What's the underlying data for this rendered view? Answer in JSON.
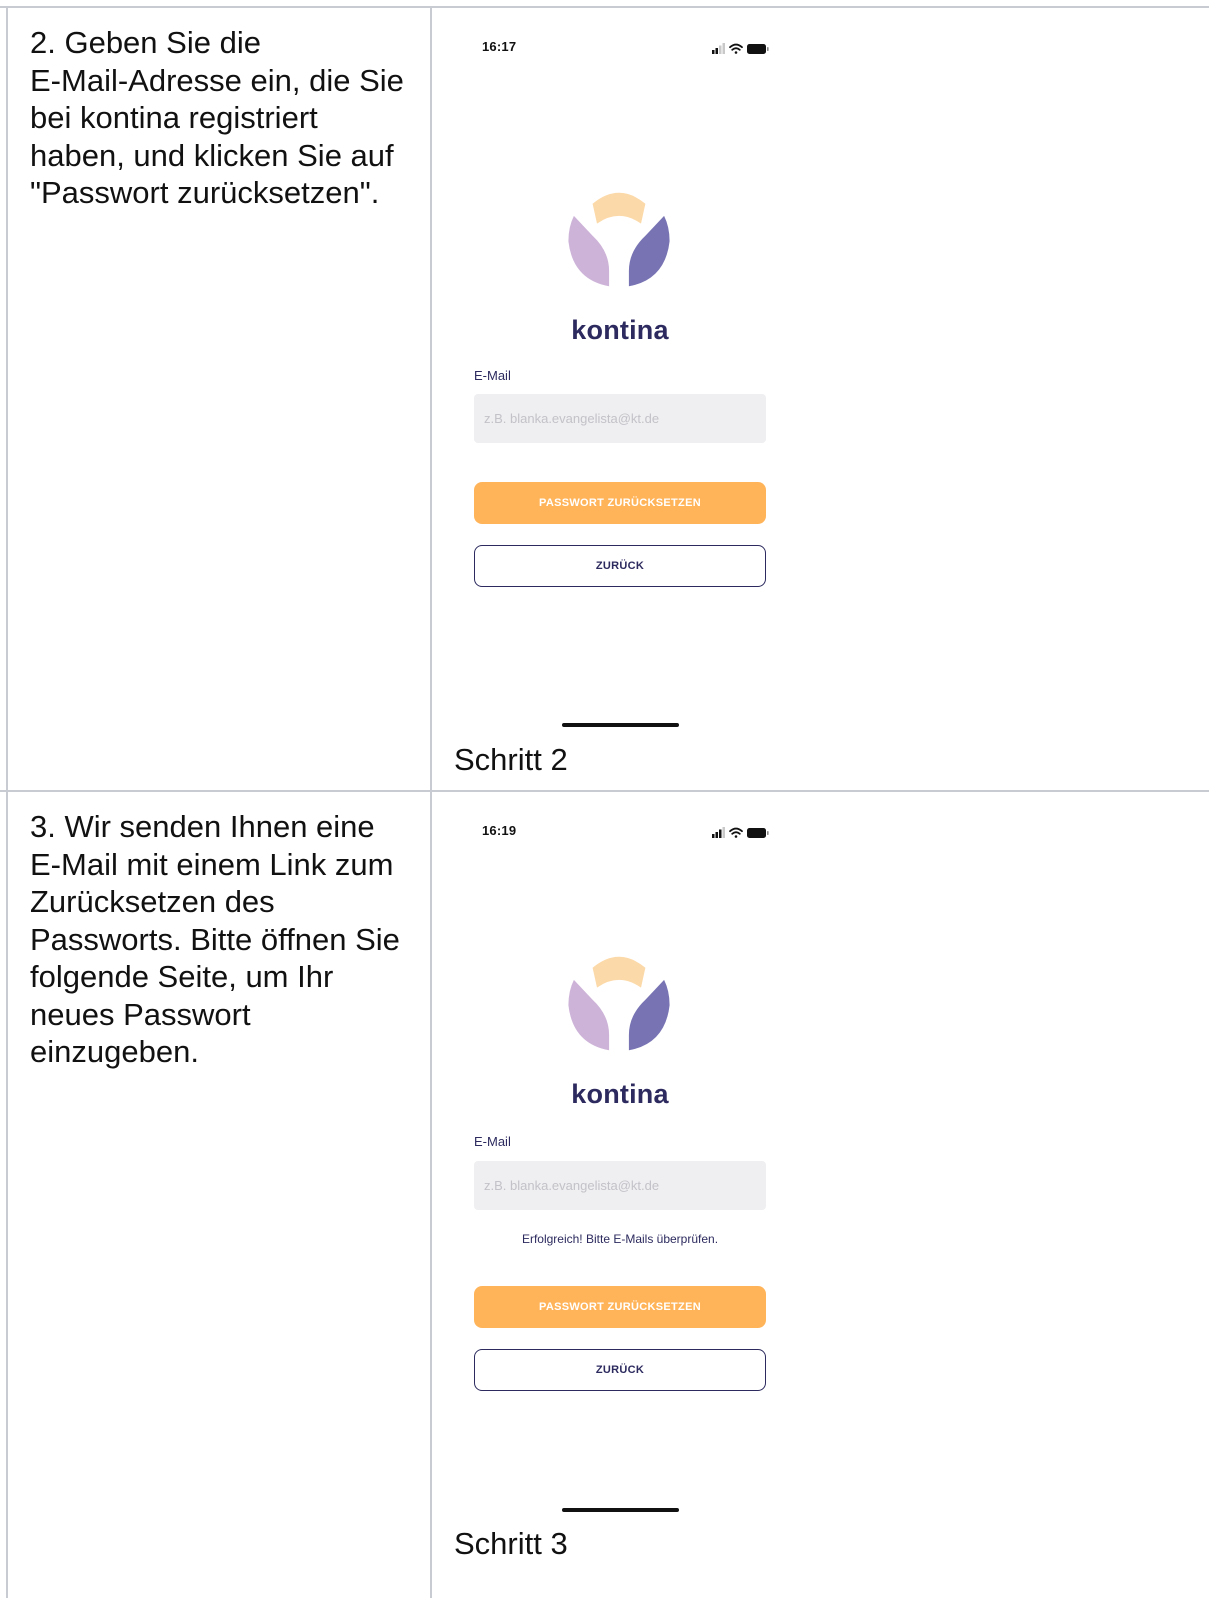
{
  "steps": [
    {
      "instruction": "2. Geben Sie die\nE-Mail-Adresse ein, die Sie\nbei kontina registriert\nhaben, und klicken Sie auf\n\"Passwort zurücksetzen\".",
      "caption": "Schritt 2",
      "phone": {
        "time": "16:17",
        "brand": "kontina",
        "email_label": "E-Mail",
        "email_placeholder": "z.B. blanka.evangelista@kt.de",
        "success_message": "",
        "primary_button": "PASSWORT ZURÜCKSETZEN",
        "secondary_button": "ZURÜCK"
      }
    },
    {
      "instruction": "3. Wir senden Ihnen eine\nE-Mail mit einem Link zum\nZurücksetzen des\nPassworts. Bitte öffnen Sie\nfolgende Seite, um Ihr\nneues Passwort\neinzugeben.",
      "caption": "Schritt 3",
      "phone": {
        "time": "16:19",
        "brand": "kontina",
        "email_label": "E-Mail",
        "email_placeholder": "z.B. blanka.evangelista@kt.de",
        "success_message": "Erfolgreich! Bitte E-Mails überprüfen.",
        "primary_button": "PASSWORT ZURÜCKSETZEN",
        "secondary_button": "ZURÜCK"
      }
    }
  ],
  "icons": {
    "signal": "signal-icon",
    "wifi": "wifi-icon",
    "battery": "battery-icon",
    "logo": "kontina-logo-icon"
  },
  "colors": {
    "brand_dark": "#2c2a5e",
    "button_orange": "#ffb45a",
    "logo_peach": "#fcd9a8",
    "logo_lilac": "#cdb3d8",
    "logo_violet": "#7874b4",
    "input_bg": "#efeff1",
    "grid_line": "#c8cbd2"
  }
}
